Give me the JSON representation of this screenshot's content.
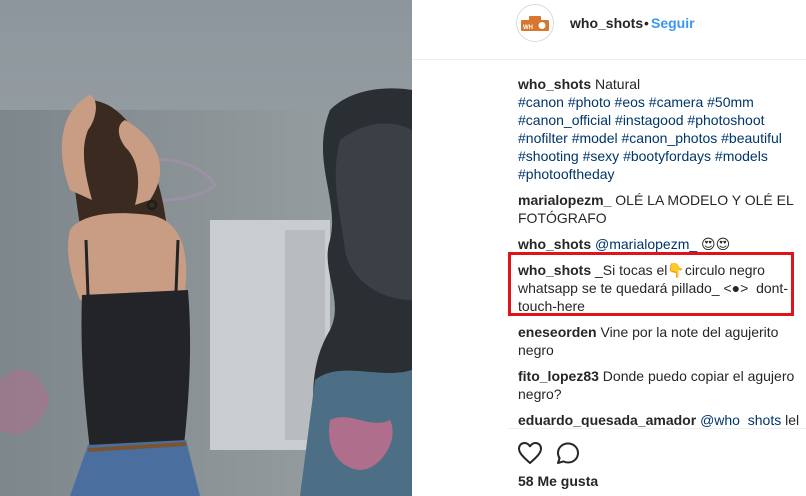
{
  "header": {
    "username": "who_shots",
    "separator": "•",
    "follow_label": "Seguir",
    "avatar_icon": "who-shots-logo"
  },
  "comments": [
    {
      "user": "who_shots",
      "text": "Natural",
      "tags": "#canon #photo #eos #camera #50mm #canon_official #instagood #photoshoot #nofilter #model #canon_photos #beautiful #shooting #sexy #bootyfordays #models #photooftheday"
    },
    {
      "user": "marialopezm_",
      "text": "OLÉ LA MODELO Y OLÉ EL FOTÓGRAFO"
    },
    {
      "user": "who_shots",
      "mention": "@marialopezm_",
      "text": "😍😍"
    },
    {
      "user": "who_shots",
      "text": "_Si tocas el👇circulo negro whatsapp se te quedará pillado_ <●> ⁣⁣⁣⁣ dont-touch-here",
      "highlighted": true
    },
    {
      "user": "eneseorden",
      "text": "Vine por la note del agujerito negro"
    },
    {
      "user": "fito_lopez83",
      "text": "Donde puedo copiar el agujero negro?"
    },
    {
      "user": "eduardo_quesada_amador",
      "mention": "@who_shots",
      "text": "lel funciona"
    }
  ],
  "actions": {
    "like_icon": "heart-icon",
    "comment_icon": "comment-icon",
    "likes_label": "58 Me gusta"
  },
  "colors": {
    "link": "#3897f0",
    "hashtag": "#003569",
    "highlight_box": "#e0121b",
    "text": "#262626"
  }
}
